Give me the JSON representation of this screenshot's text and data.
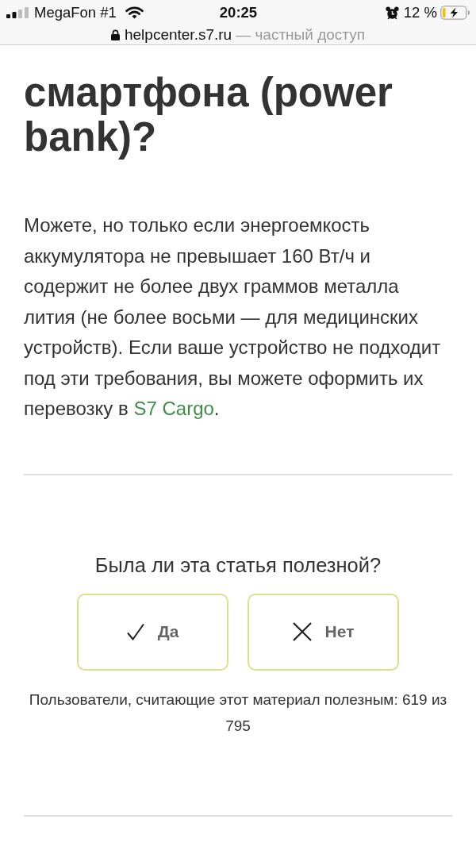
{
  "status_bar": {
    "carrier": "MegaFon #1",
    "time": "20:25",
    "battery_percent": "12 %"
  },
  "address_bar": {
    "domain": "helpcenter.s7.ru",
    "note": "— частный доступ"
  },
  "article": {
    "title": "смартфона (power bank)?",
    "body": [
      {
        "kind": "text",
        "text": "Можете, но только если энергоемкость аккумулятора не превышает 160 Вт/ч и содержит не более двух граммов металла лития (не более восьми — для медицинских устройств). Если ваше устройство не подходит под эти требования, вы можете оформить их перевозку в "
      },
      {
        "kind": "link",
        "text": "S7 Cargo"
      },
      {
        "kind": "text",
        "text": "."
      }
    ]
  },
  "feedback": {
    "question": "Была ли эта статья полезной?",
    "buttons": [
      {
        "kind": "yes",
        "label": "Да"
      },
      {
        "kind": "no",
        "label": "Нет"
      }
    ],
    "stats": "Пользователи, считающие этот материал полезным: 619 из 795"
  }
}
